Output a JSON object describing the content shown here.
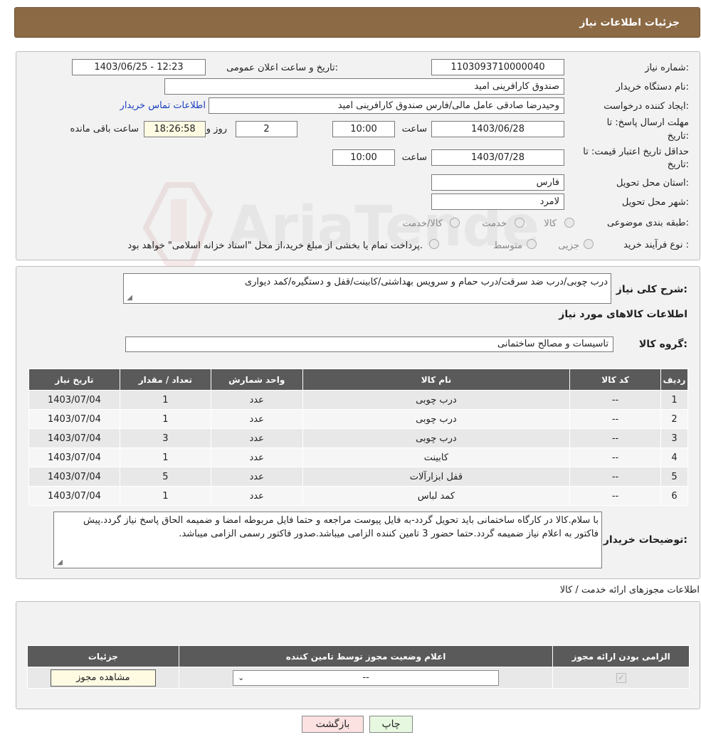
{
  "header": {
    "title": "جزئیات اطلاعات نیاز"
  },
  "form": {
    "need_number_label": "شماره نیاز:",
    "need_number": "1103093710000040",
    "announce_label": "تاریخ و ساعت اعلان عمومی:",
    "announce_value": "1403/06/25 - 12:23",
    "buyer_org_label": "نام دستگاه خریدار:",
    "buyer_org": "صندوق کارافرینی امید",
    "creator_label": "ایجاد کننده درخواست:",
    "creator": "وحیدرضا صادقی عامل مالی/فارس صندوق کارافرینی امید",
    "contact_link": "اطلاعات تماس خریدار",
    "deadline_label_1": "مهلت ارسال پاسخ: تا",
    "deadline_label_2": "تاریخ:",
    "deadline_date": "1403/06/28",
    "time_label": "ساعت",
    "deadline_time": "10:00",
    "days_value": "2",
    "days_label": "روز و",
    "remaining_time": "18:26:58",
    "remaining_label": "ساعت باقی مانده",
    "validity_label_1": "حداقل تاریخ اعتبار قیمت: تا",
    "validity_label_2": "تاریخ:",
    "validity_date": "1403/07/28",
    "validity_time_label": "ساعت",
    "validity_time": "10:00",
    "province_label": "استان محل تحویل:",
    "province": "فارس",
    "city_label": "شهر محل تحویل:",
    "city": "لامرد",
    "category_label": "طبقه بندی موضوعی:",
    "category_options": [
      "کالا",
      "خدمت",
      "کالا/خدمت"
    ],
    "process_label": "نوع فرآیند خرید :",
    "process_options": [
      "جزیی",
      "متوسط"
    ],
    "process_note": "پرداخت تمام یا بخشی از مبلغ خرید،از محل \"اسناد خزانه اسلامی\" خواهد بود."
  },
  "watermark": {
    "text": "AriaTender.neT"
  },
  "details": {
    "description_label": "شرح کلی نیاز:",
    "description": "درب چوبی/درب ضد سرقت/درب حمام و سرویس بهداشتی/کابینت/قفل و دستگیره/کمد دیواری",
    "goods_info_title": "اطلاعات کالاهای مورد نیاز",
    "goods_group_label": "گروه کالا:",
    "goods_group": "تاسیسات و مصالح ساختمانی",
    "table": {
      "headers": [
        "ردیف",
        "کد کالا",
        "نام کالا",
        "واحد شمارش",
        "تعداد / مقدار",
        "تاریخ نیاز"
      ],
      "rows": [
        [
          "1",
          "--",
          "درب چوبی",
          "عدد",
          "1",
          "1403/07/04"
        ],
        [
          "2",
          "--",
          "درب چوبی",
          "عدد",
          "1",
          "1403/07/04"
        ],
        [
          "3",
          "--",
          "درب چوبی",
          "عدد",
          "3",
          "1403/07/04"
        ],
        [
          "4",
          "--",
          "کابینت",
          "عدد",
          "1",
          "1403/07/04"
        ],
        [
          "5",
          "--",
          "قفل ابزارآلات",
          "عدد",
          "5",
          "1403/07/04"
        ],
        [
          "6",
          "--",
          "کمد لباس",
          "عدد",
          "1",
          "1403/07/04"
        ]
      ]
    },
    "buyer_notes_label": "توضیحات خریدار:",
    "buyer_notes": "با سلام.کالا در کارگاه ساختمانی باید تحویل گردد-به فایل پیوست مراجعه و حتما فایل مربوطه امضا و ضمیمه الحاق پاسخ نیاز گردد.پیش فاکتور به اعلام نیاز ضمیمه گردد.حتما حضور 3 تامین کننده الزامی میباشد.صدور فاکتور رسمی الزامی میباشد."
  },
  "licenses": {
    "section_title": "اطلاعات مجوزهای ارائه خدمت / کالا",
    "headers": [
      "الزامی بودن ارائه مجوز",
      "اعلام وضعیت مجوز توسط تامین کننده",
      "جزئیات"
    ],
    "select_value": "--",
    "view_button": "مشاهده مجوز"
  },
  "footer": {
    "print_button": "چاپ",
    "back_button": "بازگشت"
  }
}
